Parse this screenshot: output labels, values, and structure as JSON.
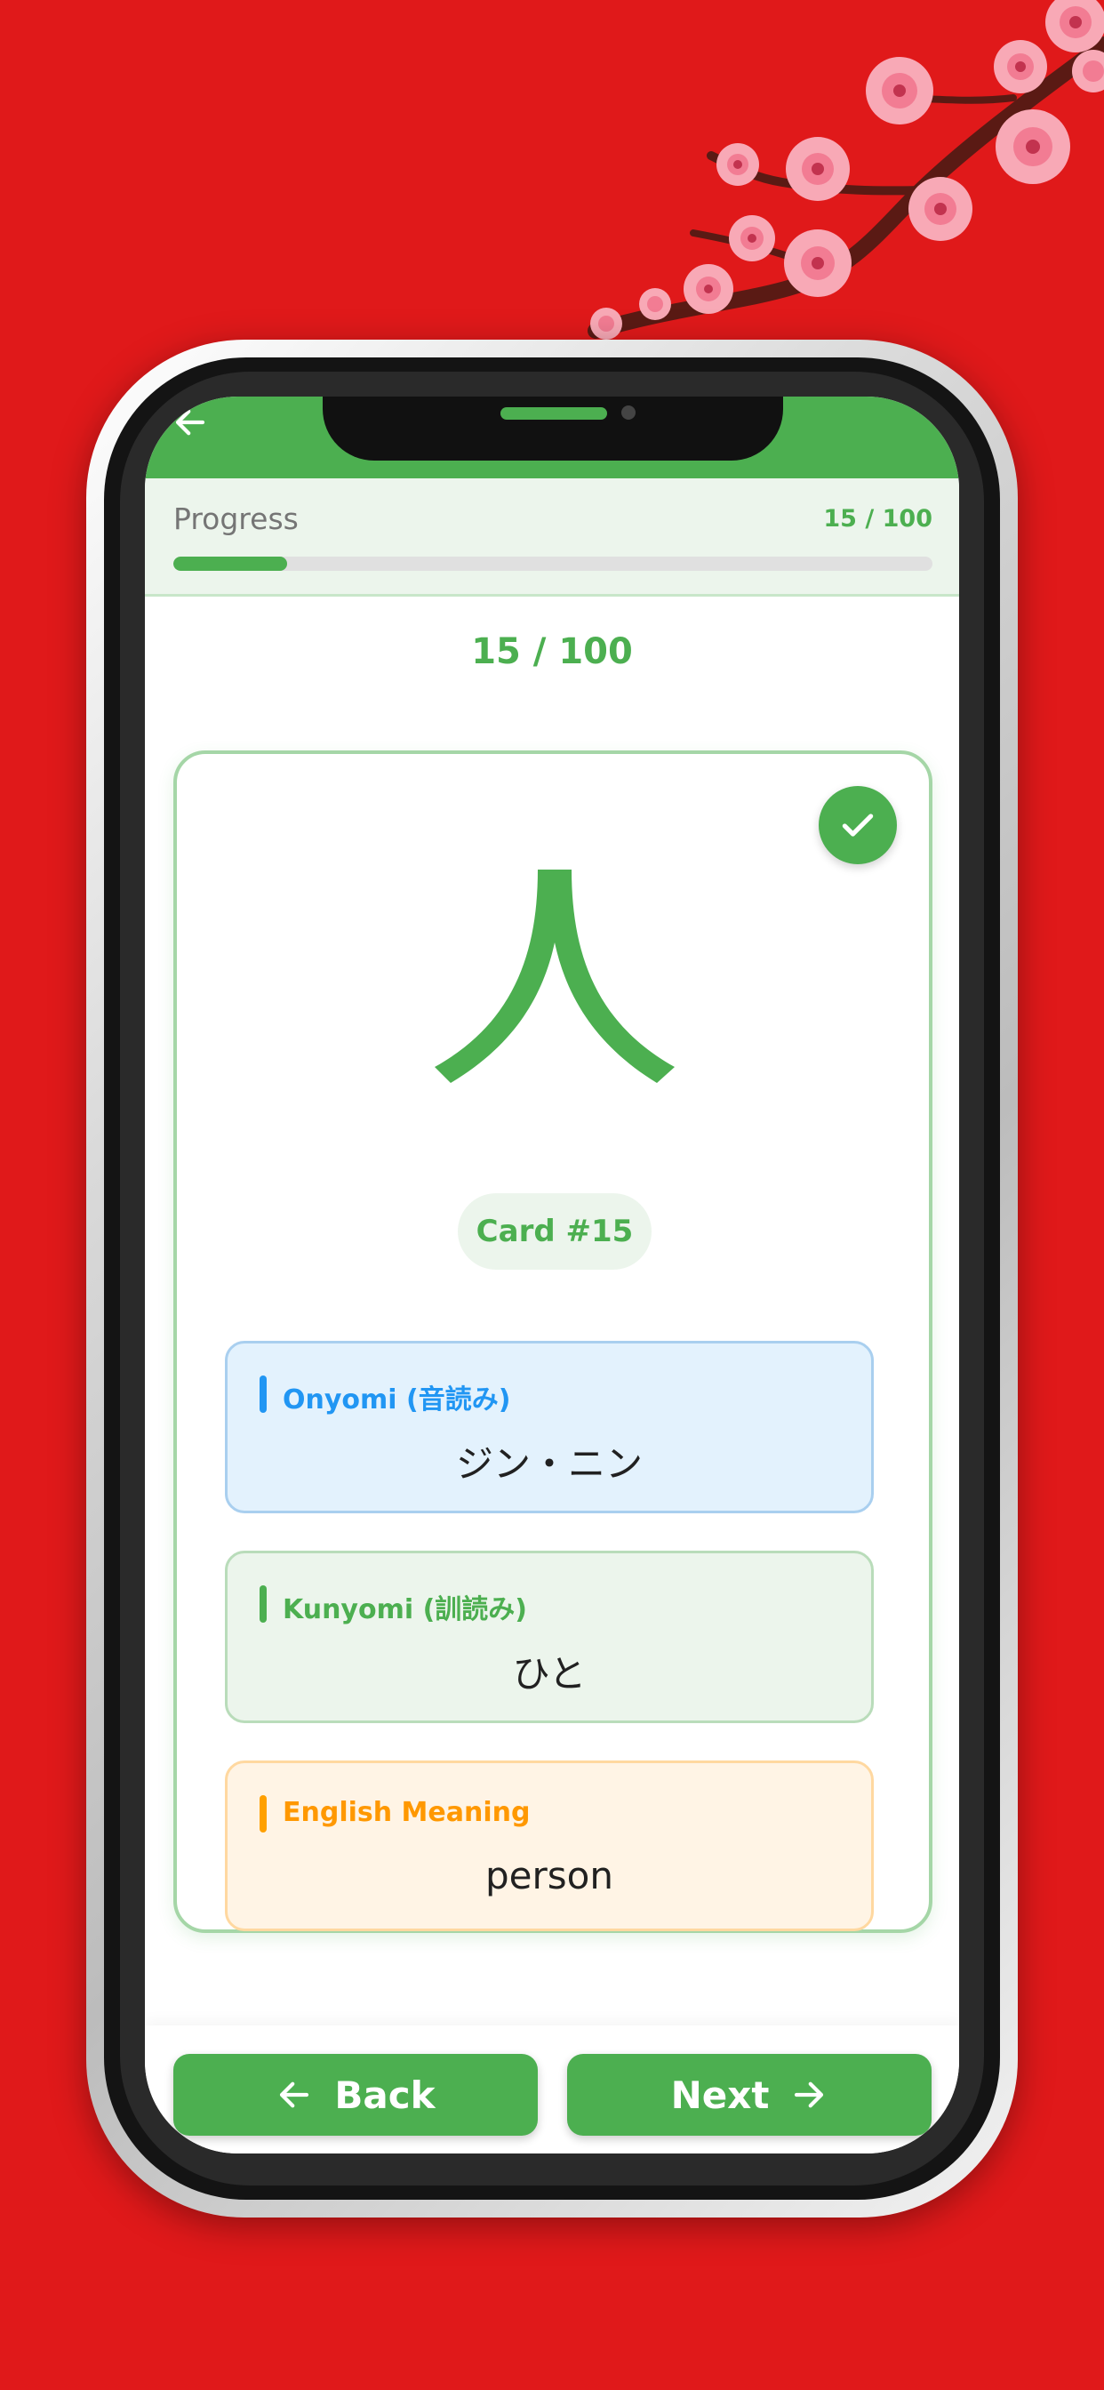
{
  "colors": {
    "background": "#e0191a",
    "accent": "#4caf50",
    "onyomi": "#2196f3",
    "kunyomi": "#4caf50",
    "meaning": "#ff9800"
  },
  "icons": {
    "back": "arrow-left-icon",
    "check": "check-icon",
    "next": "arrow-right-icon"
  },
  "progress": {
    "label": "Progress",
    "count": "15 / 100",
    "fraction": 0.15
  },
  "counter": "15 / 100",
  "card": {
    "kanji": "人",
    "badge": "Card #15",
    "completed": true,
    "onyomi": {
      "title": "Onyomi (音読み)",
      "value": "ジン・ニン"
    },
    "kunyomi": {
      "title": "Kunyomi (訓読み)",
      "value": "ひと"
    },
    "meaning": {
      "title": "English Meaning",
      "value": "person"
    }
  },
  "nav": {
    "back_label": "Back",
    "next_label": "Next"
  }
}
